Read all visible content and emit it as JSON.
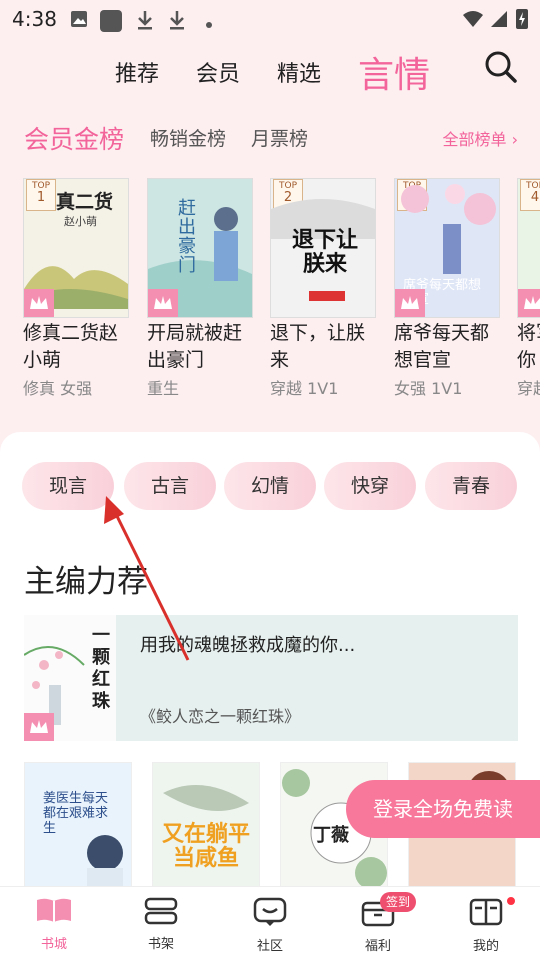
{
  "status_bar": {
    "time": "4:38"
  },
  "top_nav": {
    "tabs": [
      {
        "label": "推荐",
        "active": false
      },
      {
        "label": "会员",
        "active": false
      },
      {
        "label": "精选",
        "active": false
      },
      {
        "label": "言情",
        "active": true
      }
    ],
    "search_icon": "search-icon"
  },
  "rank_tabs": {
    "items": [
      {
        "label": "会员金榜",
        "active": true
      },
      {
        "label": "畅销金榜",
        "active": false
      },
      {
        "label": "月票榜",
        "active": false
      }
    ],
    "all_label": "全部榜单 ›"
  },
  "ranked_books": [
    {
      "rank": "1",
      "title": "修真二货赵小萌",
      "tags": "修真 女强",
      "cover_text": "真二货",
      "cover_sub": "赵小萌",
      "bg": "#f4f1e6"
    },
    {
      "rank": "1",
      "title": "开局就被赶出豪门",
      "tags": "重生",
      "cover_text": "赶出豪门",
      "cover_sub": "",
      "bg": "#cde5e3"
    },
    {
      "rank": "2",
      "title": "退下，让朕来",
      "tags": "穿越 1V1",
      "cover_text": "退下让朕来",
      "cover_sub": "",
      "bg": "#f2f2f2"
    },
    {
      "rank": "3",
      "title": "席爷每天都想官宣",
      "tags": "女强 1V1",
      "cover_text": "席爷每天都想官宣",
      "cover_sub": "",
      "bg": "#dfe6f6"
    },
    {
      "rank": "4",
      "title": "将军喊你",
      "tags": "穿越",
      "cover_text": "",
      "cover_sub": "",
      "bg": "#e9f3e6"
    }
  ],
  "top_label": "TOP",
  "categories": [
    "现言",
    "古言",
    "幻情",
    "快穿",
    "青春"
  ],
  "section_title": "主编力荐",
  "recommend": {
    "desc": "用我的魂魄拯救成魔的你...",
    "book": "《鲛人恋之一颗红珠》",
    "cover_text": "一颗红珠"
  },
  "grid_books": [
    {
      "cover_text": "姜医生每天都在艰难求生",
      "bg": "#e8f3fb"
    },
    {
      "cover_text": "又在躺平当咸鱼",
      "bg": "#eef4ee"
    },
    {
      "cover_text": "丁薇",
      "bg": "#f5f8f2"
    },
    {
      "cover_text": "",
      "bg": "#f4d6c8"
    }
  ],
  "login_button": "登录全场免费读",
  "bottom_tabs": [
    {
      "label": "书城",
      "icon": "book-city-icon",
      "active": true
    },
    {
      "label": "书架",
      "icon": "bookshelf-icon",
      "active": false
    },
    {
      "label": "社区",
      "icon": "community-icon",
      "active": false
    },
    {
      "label": "福利",
      "icon": "welfare-icon",
      "active": false
    },
    {
      "label": "我的",
      "icon": "profile-icon",
      "active": false
    }
  ],
  "checkin_badge": "签到",
  "colors": {
    "accent": "#f2649a",
    "bg": "#fdeef0"
  }
}
